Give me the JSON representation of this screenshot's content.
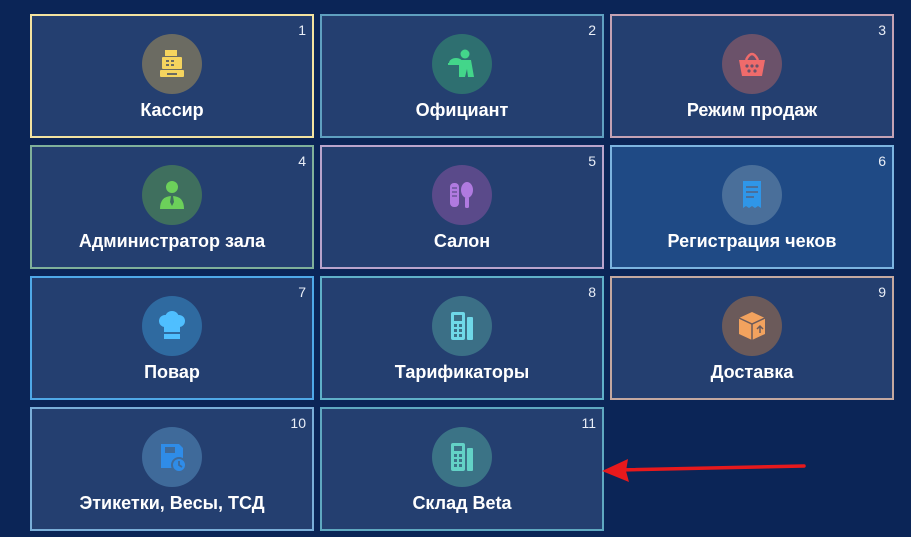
{
  "tiles": [
    {
      "num": "1",
      "label": "Кассир",
      "icon": "cash-register-icon",
      "border": "#f3e3a0",
      "circle": "#6b6b62",
      "iconColor": "#f5d45e"
    },
    {
      "num": "2",
      "label": "Официант",
      "icon": "waiter-icon",
      "border": "#5fa0c0",
      "circle": "#2e6f70",
      "iconColor": "#43d68a"
    },
    {
      "num": "3",
      "label": "Режим продаж",
      "icon": "shopping-basket-icon",
      "border": "#c4a2b4",
      "circle": "#6b526a",
      "iconColor": "#ef6b6b"
    },
    {
      "num": "4",
      "label": "Администратор зала",
      "icon": "administrator-icon",
      "border": "#7fb09a",
      "circle": "#3f6f5e",
      "iconColor": "#6cd05a"
    },
    {
      "num": "5",
      "label": "Салон",
      "icon": "salon-icon",
      "border": "#b9a4cc",
      "circle": "#5a4a8a",
      "iconColor": "#b07ae0"
    },
    {
      "num": "6",
      "label": "Регистрация чеков",
      "icon": "receipt-icon",
      "border": "#7cb4e0",
      "circle": "#4a6f9a",
      "iconColor": "#2f96e8"
    },
    {
      "num": "7",
      "label": "Повар",
      "icon": "chef-hat-icon",
      "border": "#4fa9e8",
      "circle": "#2f6aa0",
      "iconColor": "#4fbfff"
    },
    {
      "num": "8",
      "label": "Тарификаторы",
      "icon": "tariff-terminal-icon",
      "border": "#5fb0c8",
      "circle": "#3b6f86",
      "iconColor": "#6fd8e8"
    },
    {
      "num": "9",
      "label": "Доставка",
      "icon": "delivery-box-icon",
      "border": "#c4a8a0",
      "circle": "#6b5a5a",
      "iconColor": "#f2a25e"
    },
    {
      "num": "10",
      "label": "Этикетки, Весы, ТСД",
      "icon": "labels-scales-icon",
      "border": "#7aaed8",
      "circle": "#3f6a9a",
      "iconColor": "#2f8ce8"
    },
    {
      "num": "11",
      "label": "Склад Beta",
      "icon": "warehouse-icon",
      "border": "#5fa8c0",
      "circle": "#3b7386",
      "iconColor": "#63d2c6"
    }
  ],
  "colors": {
    "background": "#0b2557",
    "tile": "#243f70",
    "tileActive": "#1f4a85",
    "arrow": "#e8191c"
  }
}
